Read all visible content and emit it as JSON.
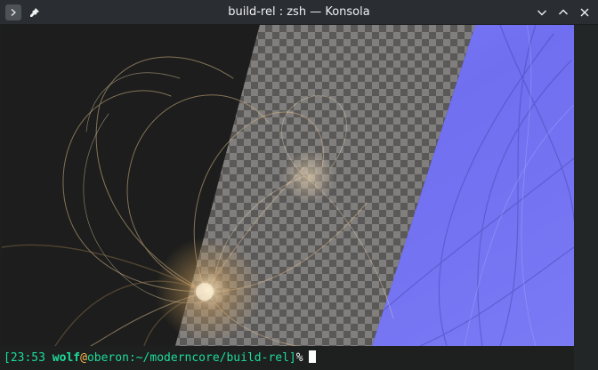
{
  "window": {
    "title": "build-rel : zsh — Konsola"
  },
  "titlebar": {
    "left_buttons": [
      {
        "name": "window-menu-icon"
      },
      {
        "name": "pin-icon"
      }
    ],
    "right_buttons": [
      {
        "name": "minimize-icon"
      },
      {
        "name": "maximize-icon"
      },
      {
        "name": "close-icon"
      }
    ]
  },
  "terminal": {
    "prompt": {
      "open_bracket": "[",
      "time": "23:53",
      "user": "wolf",
      "at": "@",
      "host": "oberon",
      "colon": ":",
      "path": "~/moderncore/build-rel",
      "close_bracket": "]",
      "sign": "%"
    }
  },
  "colors": {
    "prompt_green": "#1cdc9a",
    "prompt_at": "#fdbc4b",
    "wallpaper_blue": "#7c7cf6",
    "wallpaper_dark": "#1c1d1c"
  }
}
